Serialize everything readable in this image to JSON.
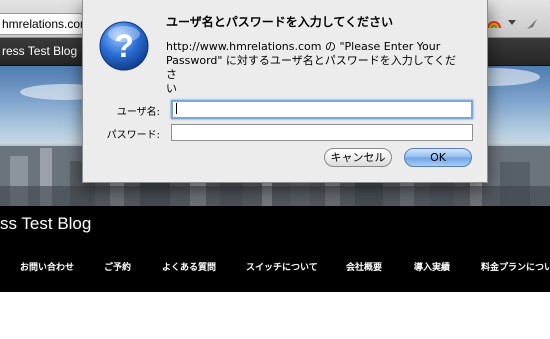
{
  "browser": {
    "url_fragment": "hmrelations.com",
    "tab_title_fragment": "ress Test Blog"
  },
  "site": {
    "title_fragment": "ss Test Blog",
    "nav": [
      "お問い合わせ",
      "ご予約",
      "よくある質問",
      "スイッチについて",
      "会社概要",
      "導入実績",
      "料金プランについ"
    ]
  },
  "dialog": {
    "title": "ユーザ名とパスワードを入力してください",
    "message_line1": "http://www.hmrelations.com の \"Please Enter Your",
    "message_line2": "Password\" に対するユーザ名とパスワードを入力してくださ",
    "message_line3": "い",
    "username_label": "ユーザ名:",
    "username_value": "",
    "password_label": "パスワード:",
    "password_value": "",
    "cancel_label": "キャンセル",
    "ok_label": "OK"
  },
  "colors": {
    "ok_button": "#8fbaf0",
    "site_header_bg": "#000000",
    "dialog_bg": "#ececec"
  }
}
